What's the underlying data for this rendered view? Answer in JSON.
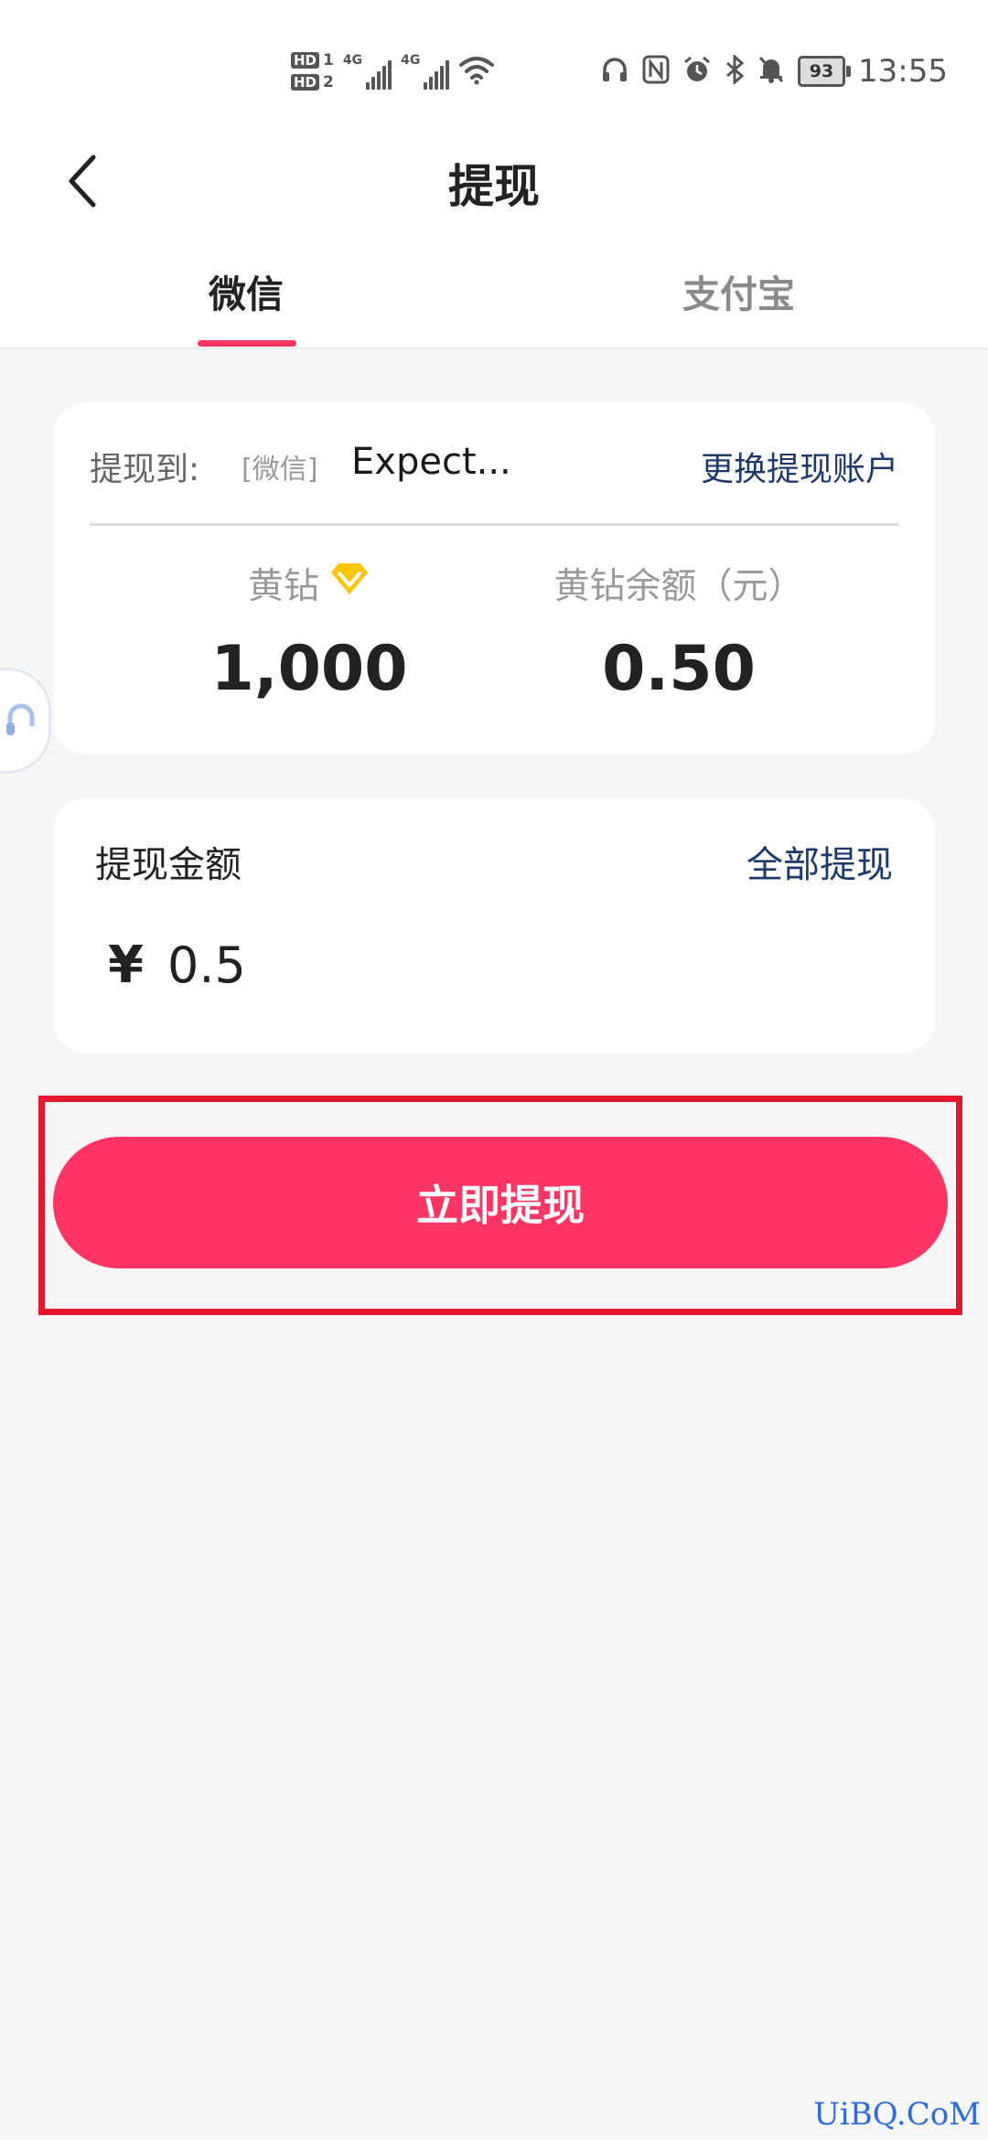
{
  "status_bar": {
    "hd1": "HD",
    "hd1_num": "1",
    "hd2": "HD",
    "hd2_num": "2",
    "net1": "4G",
    "net2": "4G",
    "battery": "93",
    "time": "13:55",
    "icons": [
      "headphones-icon",
      "nfc-icon",
      "alarm-icon",
      "bluetooth-icon",
      "mute-bell-icon"
    ]
  },
  "header": {
    "title": "提现",
    "back_icon": "chevron-left-icon"
  },
  "tabs": [
    {
      "label": "微信",
      "active": true
    },
    {
      "label": "支付宝",
      "active": false
    }
  ],
  "account": {
    "label": "提现到:",
    "method": "[微信]",
    "name": "Expect...",
    "change": "更换提现账户"
  },
  "stats": {
    "diamond_label": "黄钻",
    "diamond_icon": "diamond-icon",
    "diamond_value": "1,000",
    "balance_label": "黄钻余额（元）",
    "balance_value": "0.50"
  },
  "amount": {
    "label": "提现金额",
    "withdraw_all": "全部提现",
    "currency": "¥",
    "value": "0.5"
  },
  "action": {
    "withdraw_button": "立即提现"
  },
  "colors": {
    "accent": "#fe3464",
    "link": "#1e3a6b",
    "highlight": "#e5172c",
    "diamond": "#ffc300"
  },
  "watermark": "UiBQ.CoM"
}
